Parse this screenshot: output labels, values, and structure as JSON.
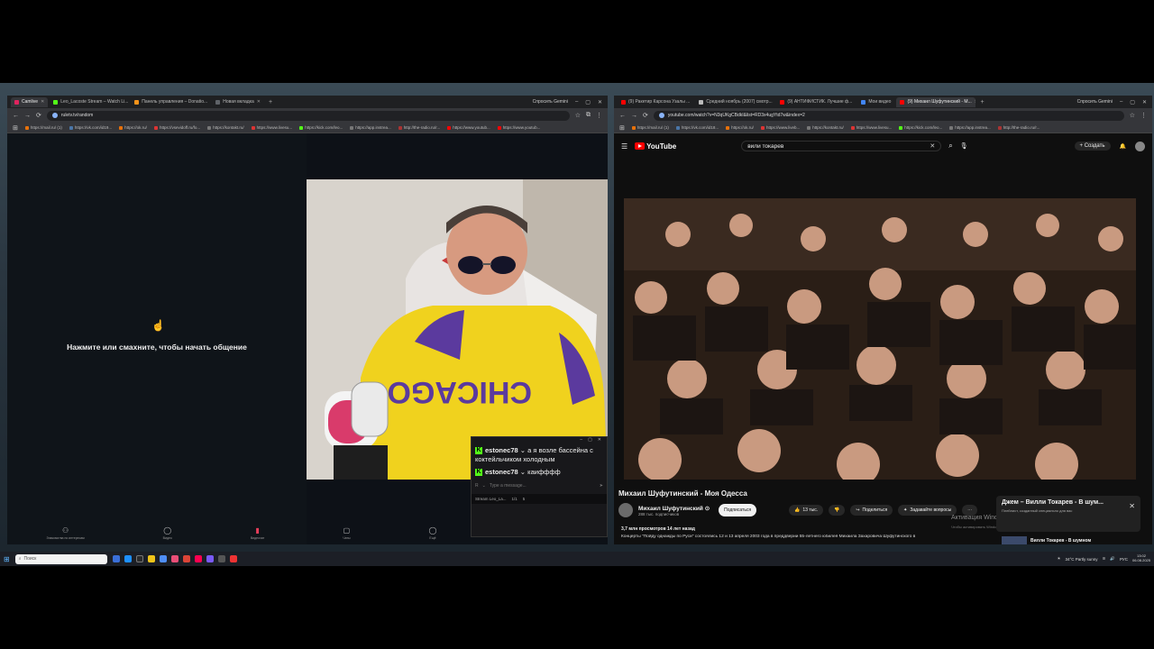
{
  "left_browser": {
    "tabs": [
      {
        "label": "Camlive",
        "active": true,
        "color": "#e0245e"
      },
      {
        "label": "Leo_Lacoste Stream – Watch Li...",
        "active": false,
        "color": "#53fc18"
      },
      {
        "label": "Панель управления – Donatio...",
        "active": false,
        "color": "#f7931a"
      },
      {
        "label": "Новая вкладка",
        "active": false,
        "color": "#5f6368"
      }
    ],
    "gemini": "Спросить Gemini",
    "url": "ruletv.tv/random",
    "bookmarks": [
      "https://mail.ru/ (1)",
      "https://vk.com/id19...",
      "https://ok.ru/",
      "https://vsevidoff.ru/fo...",
      "https://kontakt.ru/",
      "https://www.livesu...",
      "https://kick.com/leo...",
      "https://app.instrea...",
      "http://the-radio.ru/r...",
      "https://www.youtub...",
      "https://www.youtub..."
    ]
  },
  "chat_pane": {
    "hand_icon": "☝",
    "prompt": "Нажмите или смахните, чтобы начать общение"
  },
  "bottom_nav": [
    {
      "label": "Знакомства по интересам",
      "icon": "⚇",
      "active": false
    },
    {
      "label": "Видео",
      "icon": "◯",
      "active": false
    },
    {
      "label": "Видеочат",
      "icon": "▮",
      "active": true
    },
    {
      "label": "Чаты",
      "icon": "▢",
      "active": false
    },
    {
      "label": "Ещё",
      "icon": "◯",
      "active": false
    }
  ],
  "chat_widget": {
    "messages": [
      {
        "user": "estonec78",
        "text": "а я возле бассейна с коктейльчиком холодным"
      },
      {
        "user": "estonec78",
        "text": "каифффф"
      }
    ],
    "input_placeholder": "Type a message...",
    "footer": [
      "Stream Leo_La...",
      "1/1",
      "5"
    ]
  },
  "right_browser": {
    "tabs": [
      {
        "label": "(9) Ракетир Карсона Узалы ...",
        "active": false,
        "color": "#ff0000"
      },
      {
        "label": "Средний ноябрь (2007) смотр...",
        "active": false,
        "color": "#bbbbbb"
      },
      {
        "label": "(9) АНТИФИСТИК. Лучшие ф...",
        "active": false,
        "color": "#ff0000"
      },
      {
        "label": "Мои видео",
        "active": false,
        "color": "#4285f4"
      },
      {
        "label": "(9) Михаил Шуфутинский - М...",
        "active": true,
        "color": "#ff0000"
      }
    ],
    "gemini": "Спросить Gemini",
    "url": "youtube.com/watch?v=N3qUKgCBdkI&list=RD3x4ugYtd7w&index=2",
    "bookmarks": [
      "https://mail.ru/ (1)",
      "https://vk.com/id18...",
      "https://ok.ru/",
      "https://www.liveb...",
      "https://kontakt.ru/",
      "https://www.livesu...",
      "https://kick.com/leo...",
      "https://app.instrea...",
      "http://the-radio.ru/r..."
    ]
  },
  "youtube": {
    "logo": "YouTube",
    "search_value": "вили токарев",
    "create": "Создать",
    "video_title": "Михаил Шуфутинский - Моя Одесса",
    "channel": "Михаил Шуфутинский",
    "subs": "288 тыс. подписчиков",
    "subscribe": "Подписаться",
    "likes": "13 тыс.",
    "share": "Поделиться",
    "ask": "Задавайте вопросы",
    "views": "3,7 млн просмотров  14 лет назад",
    "description": "Концерты \"Пойду однажды по Руси\" состоялись 12 и 13 апреля 2003 года в преддверии 55-летнего юбилея Михаила Захаровича Шуфутинского в",
    "popup_title": "Джем – Вилли Токарев - В шум...",
    "popup_sub": "Плейлист, созданный специально для вас",
    "activation": "Активация Windows",
    "activation_sub": "Чтобы активировать Windows, перейдите в раздел \"Параметры\".",
    "rec_title": "Вилли Токарев - В шумном"
  },
  "taskbar": {
    "search": "Поиск",
    "weather": "34°C  Partly sunny",
    "lang": "РУС",
    "time": "13:02",
    "date": "06.08.2025"
  }
}
